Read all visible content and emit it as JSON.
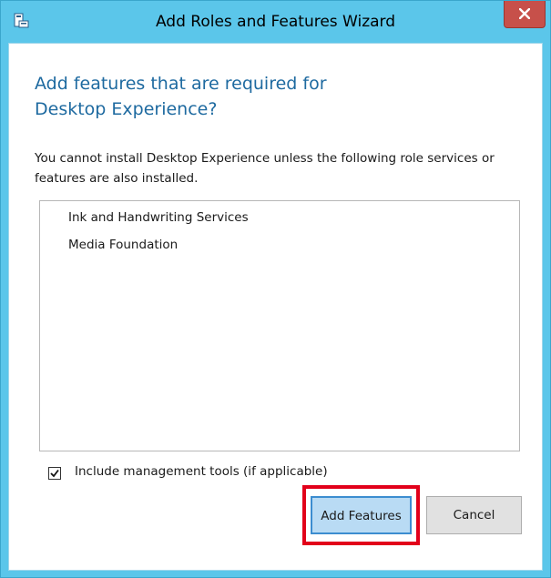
{
  "window": {
    "title": "Add Roles and Features Wizard",
    "accent_color": "#5bc6ea",
    "close_button_color": "#c7504a",
    "app_icon": "server-manager-icon",
    "close_icon": "close-icon"
  },
  "dialog": {
    "heading": "Add features that are required for Desktop Experience?",
    "description": "You cannot install Desktop Experience unless the following role services or features are also installed.",
    "required_features": [
      "Ink and Handwriting Services",
      "Media Foundation"
    ],
    "include_tools": {
      "label": "Include management tools (if applicable)",
      "checked": true
    },
    "buttons": {
      "add_features": "Add Features",
      "cancel": "Cancel"
    },
    "highlight_color": "#e2001a"
  }
}
